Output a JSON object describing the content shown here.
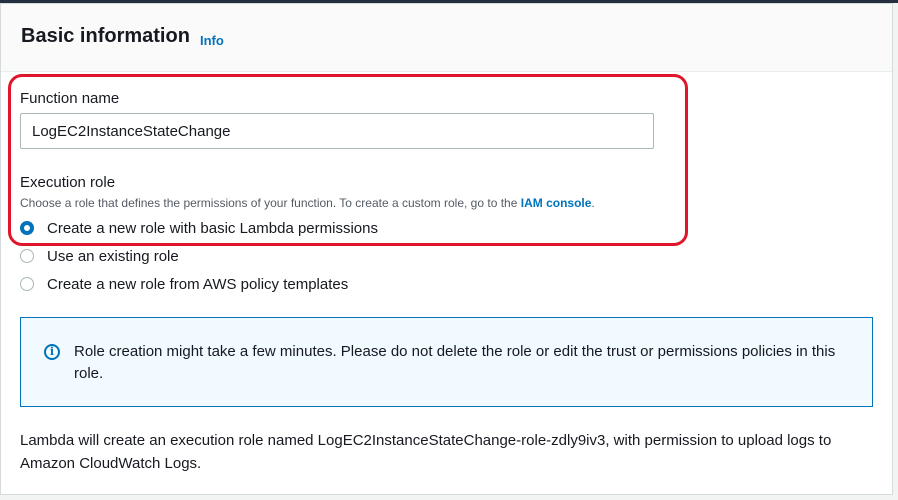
{
  "panel": {
    "title": "Basic information",
    "info_link": "Info"
  },
  "function_name": {
    "label": "Function name",
    "value": "LogEC2InstanceStateChange"
  },
  "execution_role": {
    "label": "Execution role",
    "description_prefix": "Choose a role that defines the permissions of your function. To create a custom role, go to the ",
    "description_link": "IAM console",
    "description_suffix": ".",
    "options": [
      {
        "label": "Create a new role with basic Lambda permissions",
        "selected": true
      },
      {
        "label": "Use an existing role",
        "selected": false
      },
      {
        "label": "Create a new role from AWS policy templates",
        "selected": false
      }
    ]
  },
  "alert": {
    "icon": "info-circle-icon",
    "text": "Role creation might take a few minutes. Please do not delete the role or edit the trust or permissions policies in this role."
  },
  "footer": {
    "text": "Lambda will create an execution role named LogEC2InstanceStateChange-role-zdly9iv3, with permission to upload logs to Amazon CloudWatch Logs."
  },
  "colors": {
    "accent": "#0073bb",
    "highlight": "#e0162b",
    "alert_background": "#f1faff"
  }
}
